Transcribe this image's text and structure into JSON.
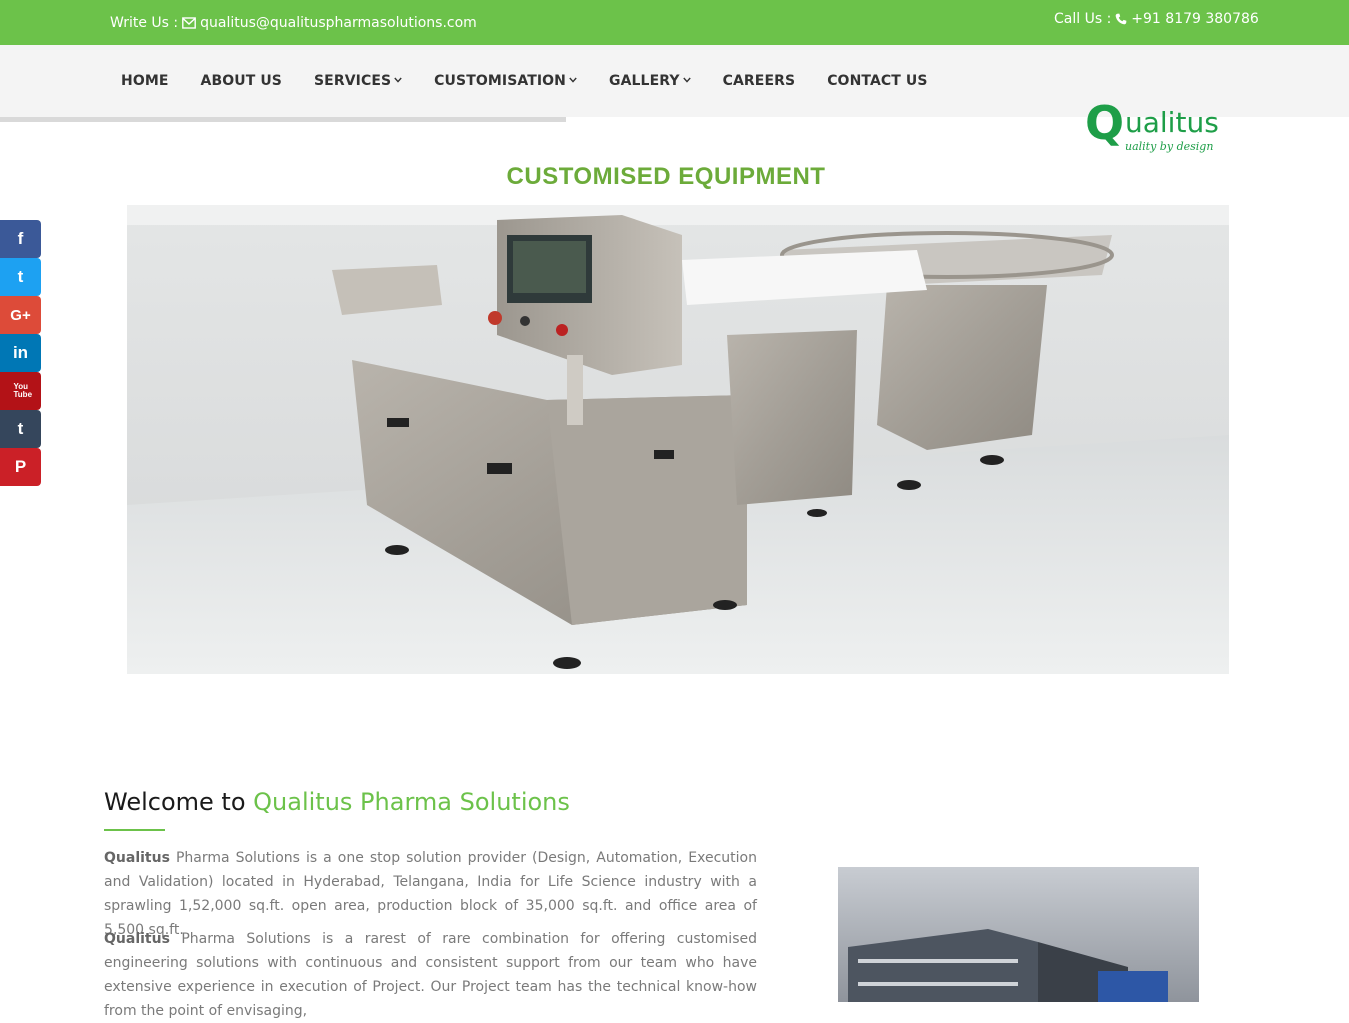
{
  "topbar": {
    "write_label": "Write Us :",
    "email": "qualitus@qualituspharmasolutions.com",
    "call_label": "Call Us :",
    "phone": "+91 8179 380786"
  },
  "nav": {
    "items": [
      {
        "label": "HOME",
        "dropdown": false
      },
      {
        "label": "ABOUT US",
        "dropdown": false
      },
      {
        "label": "SERVICES",
        "dropdown": true
      },
      {
        "label": "CUSTOMISATION",
        "dropdown": true
      },
      {
        "label": "GALLERY",
        "dropdown": true
      },
      {
        "label": "CAREERS",
        "dropdown": false
      },
      {
        "label": "CONTACT US",
        "dropdown": false
      }
    ]
  },
  "logo": {
    "q": "Q",
    "rest": "ualitus",
    "tagline": "uality by design"
  },
  "section": {
    "title": "CUSTOMISED EQUIPMENT"
  },
  "social": {
    "items": [
      {
        "name": "facebook-icon",
        "glyph": "f",
        "color": "#3b5998"
      },
      {
        "name": "twitter-icon",
        "glyph": "t",
        "color": "#1da1f2"
      },
      {
        "name": "google-plus-icon",
        "glyph": "G+",
        "color": "#dd4b39"
      },
      {
        "name": "linkedin-icon",
        "glyph": "in",
        "color": "#0077b5"
      },
      {
        "name": "youtube-icon",
        "glyph": "You Tube",
        "color": "#b31217"
      },
      {
        "name": "tumblr-icon",
        "glyph": "t",
        "color": "#35465c"
      },
      {
        "name": "pinterest-icon",
        "glyph": "P",
        "color": "#cb2027"
      }
    ]
  },
  "welcome": {
    "prefix": "Welcome to",
    "brand": "Qualitus Pharma Solutions"
  },
  "paragraphs": {
    "p1_bold": "Qualitus",
    "p1_text": " Pharma Solutions is a one stop solution provider (Design, Automation, Execution and Validation) located in Hyderabad, Telangana, India  for Life Science industry  with a sprawling 1,52,000 sq.ft. open area, production block of 35,000 sq.ft. and office area of 5,500 sq.ft.",
    "p2_bold": "Qualitus",
    "p2_text": " Pharma Solutions is a rarest of rare combination for offering customised engineering solutions with continuous and consistent support from our team who have extensive experience in execution of Project. Our Project team has the technical know-how from the point of envisaging,"
  },
  "colors": {
    "brand_green": "#6cc24a",
    "logo_green": "#1e9e48",
    "title_green": "#6cab3a"
  }
}
